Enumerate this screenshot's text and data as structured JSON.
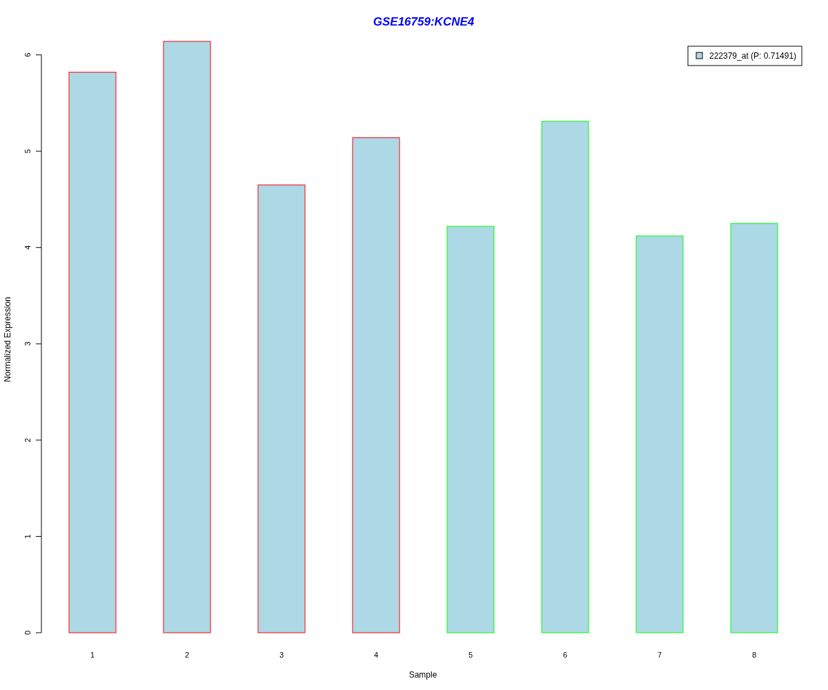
{
  "chart_data": {
    "type": "bar",
    "title": "GSE16759:KCNE4",
    "xlabel": "Sample",
    "ylabel": "Normalized Expression",
    "categories": [
      "1",
      "2",
      "3",
      "4",
      "5",
      "6",
      "7",
      "8"
    ],
    "series": [
      {
        "name": "222379_at (P: 0.71491)",
        "color": "#ff0000",
        "values": [
          5.82,
          6.14,
          4.65,
          5.14,
          null,
          null,
          null,
          null
        ]
      },
      {
        "color": "#00ff00",
        "values": [
          null,
          null,
          null,
          null,
          4.22,
          5.31,
          4.12,
          4.25
        ]
      }
    ],
    "ylim": [
      0,
      6.14
    ],
    "yticks": [
      0,
      1,
      2,
      3,
      4,
      5,
      6
    ]
  }
}
